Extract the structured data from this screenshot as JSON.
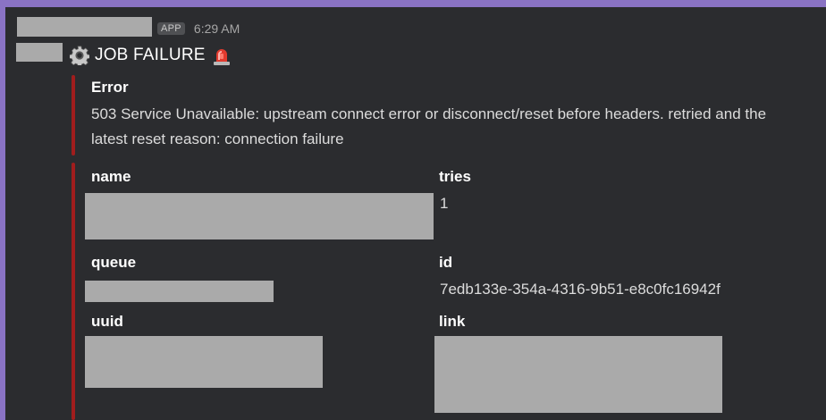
{
  "message": {
    "app_badge": "APP",
    "time": "6:29 AM",
    "title": "JOB FAILURE"
  },
  "error_block": {
    "label": "Error",
    "text": "503 Service Unavailable: upstream connect error or disconnect/reset before headers. retried and the latest reset reason: connection failure"
  },
  "fields": {
    "name": {
      "label": "name"
    },
    "tries": {
      "label": "tries",
      "value": "1"
    },
    "queue": {
      "label": "queue"
    },
    "id": {
      "label": "id",
      "value": "7edb133e-354a-4316-9b51-e8c0fc16942f"
    },
    "uuid": {
      "label": "uuid"
    },
    "link": {
      "label": "link"
    }
  },
  "icons": [
    "gear-icon",
    "siren-icon"
  ],
  "colors": {
    "background": "#2b2c2f",
    "outer": "#8a73c4",
    "attachment_bar": "#a11d1d",
    "redaction": "#aaaaaa"
  }
}
